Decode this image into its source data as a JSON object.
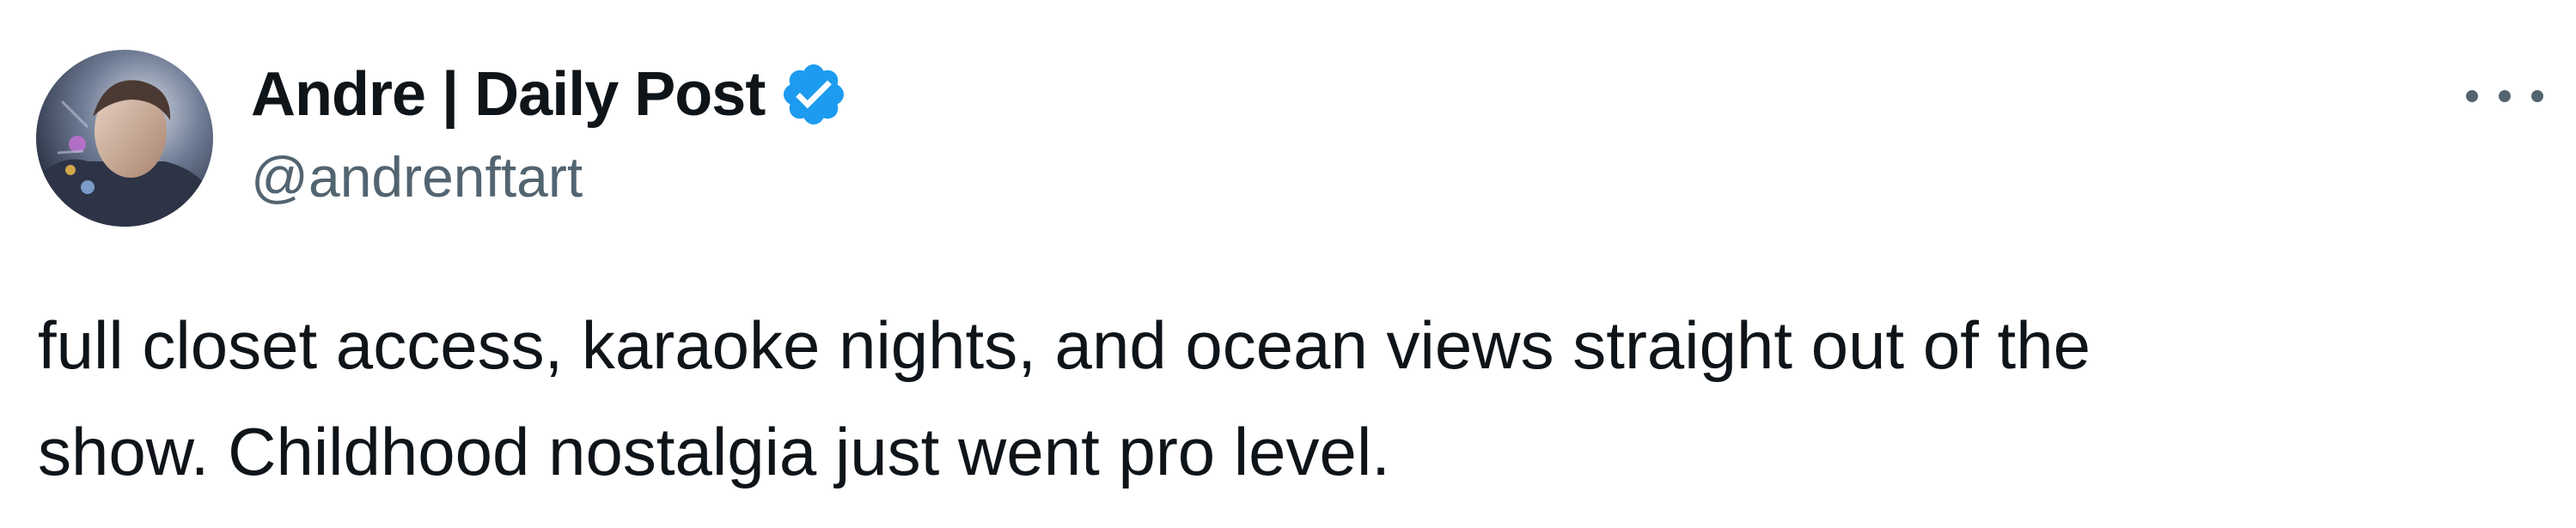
{
  "author": {
    "display_name": "Andre | Daily Post",
    "handle": "@andrenftart",
    "avatar_icon": "user-avatar",
    "verified_icon": "verified-badge-icon",
    "verified_color": "#1d9bf0"
  },
  "tweet": {
    "text_line_1": "full closet access, karaoke nights, and ocean views straight out of the",
    "text_line_2": "show. Childhood nostalgia just went pro level."
  },
  "menu": {
    "icon": "more-options-icon"
  }
}
